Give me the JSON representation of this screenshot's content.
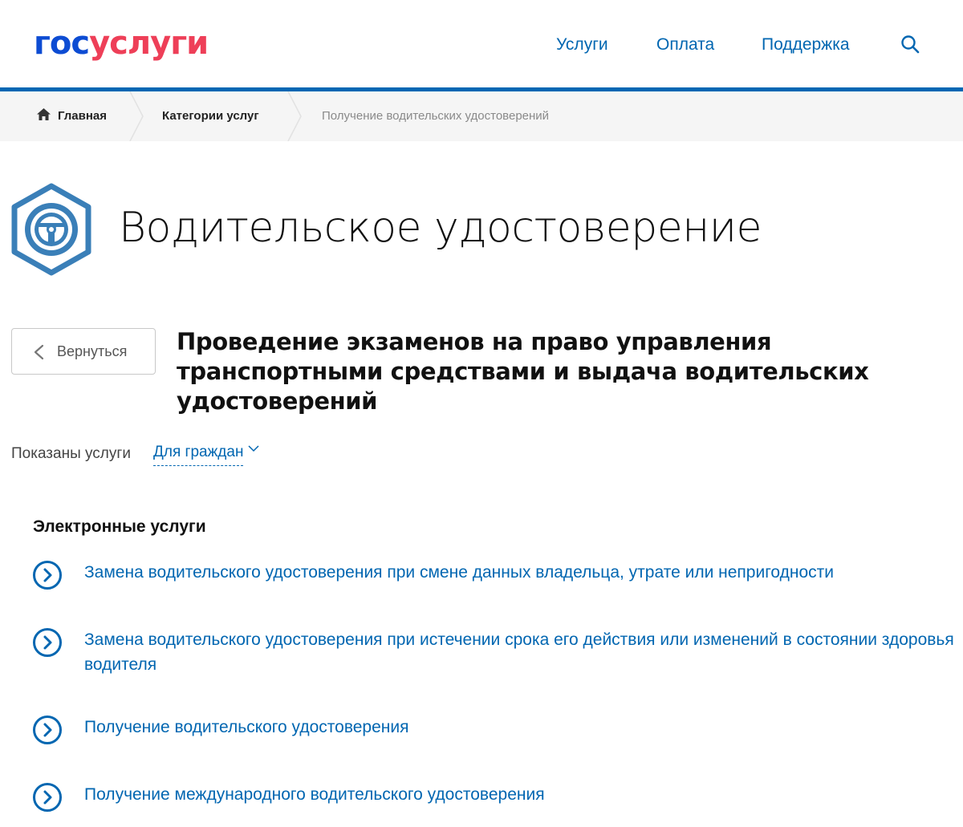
{
  "header": {
    "logo_part1": "гос",
    "logo_part2": "услуги",
    "nav": [
      "Услуги",
      "Оплата",
      "Поддержка"
    ]
  },
  "breadcrumb": {
    "home": "Главная",
    "category": "Категории услуг",
    "current": "Получение водительских удостоверений"
  },
  "page": {
    "title": "Водительское удостоверение",
    "back_label": "Вернуться",
    "subtitle": "Проведение экзаменов на право управления транспортными средствами и выдача водительских удостоверений"
  },
  "filter": {
    "label": "Показаны услуги",
    "value": "Для граждан"
  },
  "services": {
    "section_title": "Электронные услуги",
    "items": [
      "Замена водительского удостоверения при смене данных владельца, утрате или непригодности",
      "Замена водительского удостоверения при истечении срока его действия или изменений в состоянии здоровья водителя",
      "Получение водительского удостоверения",
      "Получение международного водительского удостоверения"
    ]
  },
  "colors": {
    "brand_blue": "#0d4cd3",
    "brand_red": "#ee3f58",
    "link_blue": "#0166b1",
    "icon_blue": "#3a7fb8"
  }
}
